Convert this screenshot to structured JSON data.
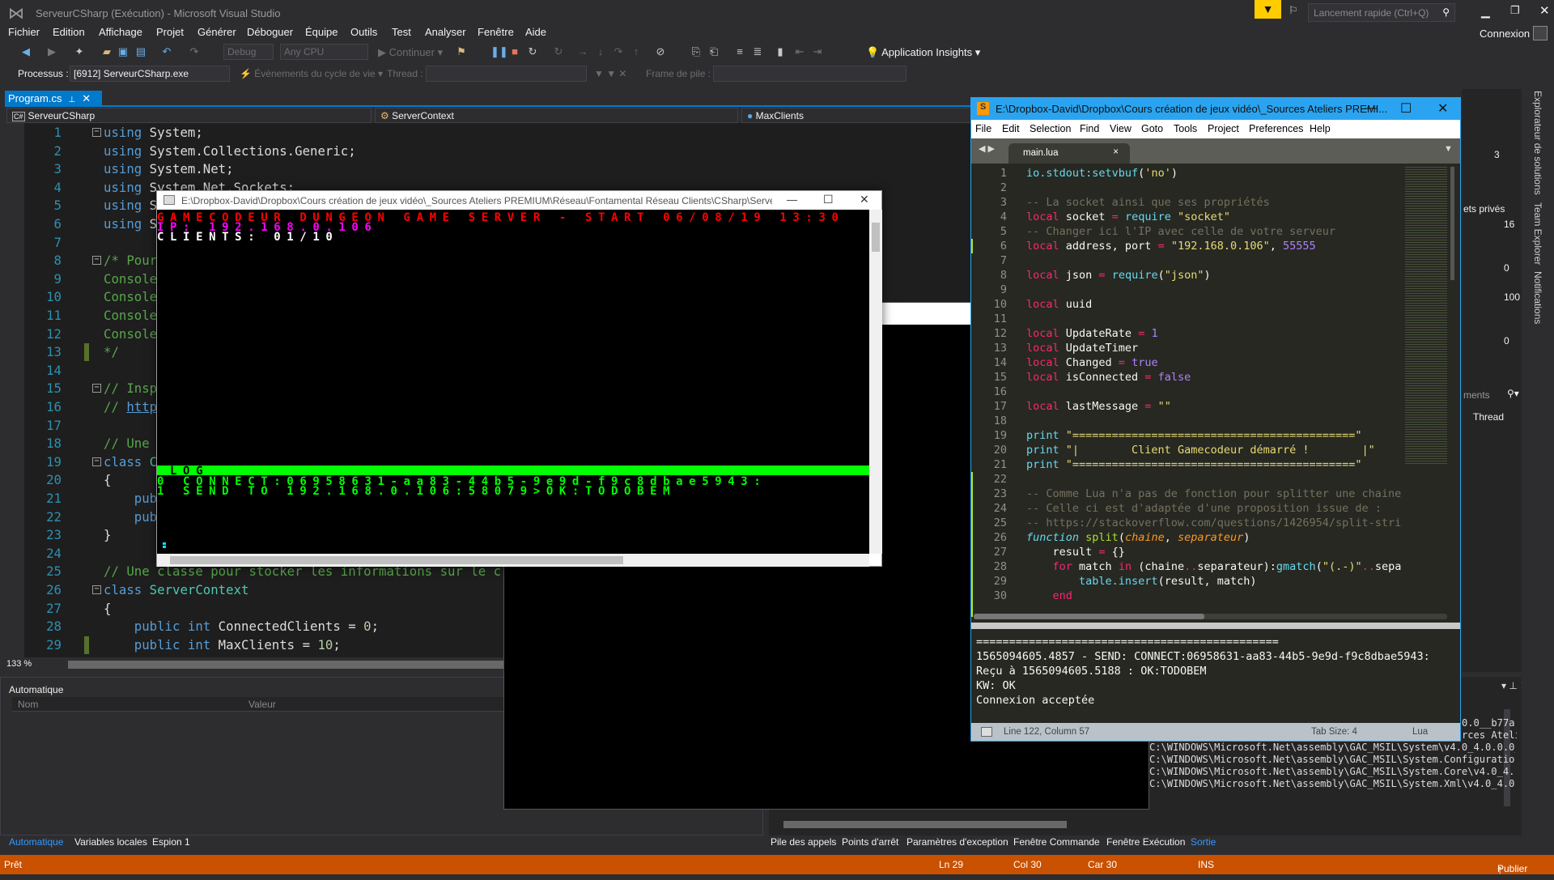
{
  "vs": {
    "title": "ServeurCSharp (Exécution) - Microsoft Visual Studio",
    "menu": [
      "Fichier",
      "Edition",
      "Affichage",
      "Projet",
      "Générer",
      "Déboguer",
      "Équipe",
      "Outils",
      "Test",
      "Analyser",
      "Fenêtre",
      "Aide"
    ],
    "toolbar": {
      "config": "Debug",
      "platform": "Any CPU",
      "continue": "Continuer",
      "app_insights": "Application Insights"
    },
    "debug_location": {
      "process_label": "Processus :",
      "process_value": "[6912] ServeurCSharp.exe",
      "lifecycle": "Événements du cycle de vie",
      "thread_label": "Thread :",
      "frame_label": "Frame de pile :"
    },
    "quick_launch_placeholder": "Lancement rapide (Ctrl+Q)",
    "signin": "Connexion",
    "doc_tab": "Program.cs",
    "nav": {
      "project": "ServeurCSharp",
      "class": "ServerContext",
      "member": "MaxClients"
    },
    "code_lines": [
      {
        "n": "1",
        "fold": "−",
        "seg": [
          [
            "using",
            "kw"
          ],
          [
            " System;",
            "tx"
          ]
        ]
      },
      {
        "n": "2",
        "seg": [
          [
            "using",
            "kw"
          ],
          [
            " System.Collections.Generic;",
            "tx"
          ]
        ]
      },
      {
        "n": "3",
        "seg": [
          [
            "using",
            "kw"
          ],
          [
            " System.Net;",
            "tx"
          ]
        ]
      },
      {
        "n": "4",
        "seg": [
          [
            "using",
            "kw"
          ],
          [
            " System.Net.Sockets;",
            "tx"
          ]
        ]
      },
      {
        "n": "5",
        "seg": [
          [
            "using",
            "kw"
          ],
          [
            " S",
            "tx"
          ]
        ]
      },
      {
        "n": "6",
        "seg": [
          [
            "using",
            "kw"
          ],
          [
            " S",
            "tx"
          ]
        ]
      },
      {
        "n": "7",
        "seg": []
      },
      {
        "n": "8",
        "fold": "−",
        "seg": [
          [
            "/* Pour",
            "cm"
          ]
        ]
      },
      {
        "n": "9",
        "seg": [
          [
            "Console",
            "cm"
          ]
        ]
      },
      {
        "n": "10",
        "seg": [
          [
            "Console",
            "cm"
          ]
        ]
      },
      {
        "n": "11",
        "seg": [
          [
            "Console",
            "cm"
          ]
        ]
      },
      {
        "n": "12",
        "seg": [
          [
            "Console",
            "cm"
          ]
        ]
      },
      {
        "n": "13",
        "mark": true,
        "seg": [
          [
            "*/",
            "cm"
          ]
        ]
      },
      {
        "n": "14",
        "seg": []
      },
      {
        "n": "15",
        "fold": "−",
        "seg": [
          [
            "// Insp",
            "cm"
          ]
        ]
      },
      {
        "n": "16",
        "seg": [
          [
            "// ",
            "cm"
          ],
          [
            "http",
            "ln"
          ]
        ]
      },
      {
        "n": "17",
        "seg": []
      },
      {
        "n": "18",
        "seg": [
          [
            "// Une",
            "cm"
          ]
        ]
      },
      {
        "n": "19",
        "fold": "−",
        "seg": [
          [
            "class",
            "kw"
          ],
          [
            " C",
            "ty"
          ]
        ]
      },
      {
        "n": "20",
        "seg": [
          [
            "{",
            "tx"
          ]
        ]
      },
      {
        "n": "21",
        "seg": [
          [
            "    pub",
            "kw"
          ]
        ]
      },
      {
        "n": "22",
        "seg": [
          [
            "    pub",
            "kw"
          ]
        ]
      },
      {
        "n": "23",
        "seg": [
          [
            "}",
            "tx"
          ]
        ]
      },
      {
        "n": "24",
        "seg": []
      },
      {
        "n": "25",
        "seg": [
          [
            "// Une classe pour stocker les informations sur le c",
            "cm"
          ]
        ]
      },
      {
        "n": "26",
        "fold": "−",
        "seg": [
          [
            "class",
            "kw"
          ],
          [
            " ServerContext",
            "ty"
          ]
        ]
      },
      {
        "n": "27",
        "seg": [
          [
            "{",
            "tx"
          ]
        ]
      },
      {
        "n": "28",
        "seg": [
          [
            "    public",
            "kw"
          ],
          [
            " int",
            "kw"
          ],
          [
            " ConnectedClients = ",
            "tx"
          ],
          [
            "0",
            "nu"
          ],
          [
            ";",
            "tx"
          ]
        ]
      },
      {
        "n": "29",
        "mark": true,
        "seg": [
          [
            "    public",
            "kw"
          ],
          [
            " int",
            "kw"
          ],
          [
            " MaxClients = ",
            "tx"
          ],
          [
            "10",
            "nu"
          ],
          [
            ";",
            "tx"
          ]
        ]
      }
    ],
    "zoom": "133 %",
    "autos": {
      "title": "Automatique",
      "col_name": "Nom",
      "col_value": "Valeur",
      "tabs": [
        "Automatique",
        "Variables locales",
        "Espion 1"
      ]
    },
    "output": {
      "tails": [
        "0.0__b77a",
        "rces Ateli"
      ],
      "lines": [
        "C:\\WINDOWS\\Microsoft.Net\\assembly\\GAC_MSIL\\System\\v4.0_4.0.0.0__",
        "C:\\WINDOWS\\Microsoft.Net\\assembly\\GAC_MSIL\\System.Configuration\\",
        "C:\\WINDOWS\\Microsoft.Net\\assembly\\GAC_MSIL\\System.Core\\v4.0_4.0.0",
        "C:\\WINDOWS\\Microsoft.Net\\assembly\\GAC_MSIL\\System.Xml\\v4.0_4.0.0"
      ]
    },
    "bottom_tabs": [
      "Pile des appels",
      "Points d'arrêt",
      "Paramètres d'exception",
      "Fenêtre Commande",
      "Fenêtre Exécution",
      "Sortie"
    ],
    "status": {
      "ready": "Prêt",
      "ln": "Ln 29",
      "col": "Col 30",
      "car": "Car 30",
      "ins": "INS",
      "publish": "Publier"
    },
    "side_tabs": [
      "Explorateur de solutions",
      "Team Explorer",
      "Notifications"
    ],
    "right_fragments": {
      "value1": "3",
      "private": "ets privés",
      "max1": "16",
      "min1": "0",
      "max2": "100",
      "min2": "0",
      "search": "ments",
      "thread": "Thread"
    },
    "accent": "#007acc",
    "status_color": "#ca5100"
  },
  "console": {
    "title": "E:\\Dropbox-David\\Dropbox\\Cours création de jeux vidéo\\_Sources Ateliers PREMIUM\\Réseau\\Fontamental Réseau Clients\\CSharp\\Serve...",
    "header_lines": [
      {
        "text": "GAMECODEUR DUNGEON GAME SERVER - START 06/08/19 13:30",
        "color": "#ff0000"
      },
      {
        "text": "IP: 192.168.0.106",
        "color": "#ff00ff"
      },
      {
        "text": "CLIENTS: 01/10",
        "color": "#ffffff"
      }
    ],
    "log_header": " LOG",
    "log_lines": [
      "0 CONNECT:06958631-aa83-44b5-9e9d-f9c8dbae5943:",
      "1 SEND TO 192.168.0.106:58079>OK:TODOBEM"
    ],
    "log_color": "#00ff00"
  },
  "sublime": {
    "title": "E:\\Dropbox-David\\Dropbox\\Cours création de jeux vidéo\\_Sources Ateliers PREMI...",
    "menu": [
      "File",
      "Edit",
      "Selection",
      "Find",
      "View",
      "Goto",
      "Tools",
      "Project",
      "Preferences",
      "Help"
    ],
    "tab": "main.lua",
    "code_lines": [
      {
        "n": "1",
        "seg": [
          [
            "io.stdout:setvbuf",
            "b"
          ],
          [
            "(",
            "w"
          ],
          [
            "'no'",
            "s"
          ],
          [
            ")",
            "w"
          ]
        ]
      },
      {
        "n": "2",
        "seg": []
      },
      {
        "n": "3",
        "seg": [
          [
            "-- La socket ainsi que ses propriétés",
            "c"
          ]
        ]
      },
      {
        "n": "4",
        "seg": [
          [
            "local",
            "k"
          ],
          [
            " socket ",
            "w"
          ],
          [
            "=",
            "k"
          ],
          [
            " require",
            "b"
          ],
          [
            " \"socket\"",
            "s"
          ]
        ]
      },
      {
        "n": "5",
        "seg": [
          [
            "-- Changer ici l'IP avec celle de votre serveur",
            "c"
          ]
        ]
      },
      {
        "n": "6",
        "seg": [
          [
            "local",
            "k"
          ],
          [
            " address, port ",
            "w"
          ],
          [
            "=",
            "k"
          ],
          [
            " \"192.168.0.106\"",
            "s"
          ],
          [
            ", ",
            "w"
          ],
          [
            "55555",
            "n"
          ]
        ]
      },
      {
        "n": "7",
        "seg": []
      },
      {
        "n": "8",
        "seg": [
          [
            "local",
            "k"
          ],
          [
            " json ",
            "w"
          ],
          [
            "=",
            "k"
          ],
          [
            " require",
            "b"
          ],
          [
            "(",
            "w"
          ],
          [
            "\"json\"",
            "s"
          ],
          [
            ")",
            "w"
          ]
        ]
      },
      {
        "n": "9",
        "seg": []
      },
      {
        "n": "10",
        "seg": [
          [
            "local",
            "k"
          ],
          [
            " uuid",
            "w"
          ]
        ]
      },
      {
        "n": "11",
        "seg": []
      },
      {
        "n": "12",
        "seg": [
          [
            "local",
            "k"
          ],
          [
            " UpdateRate ",
            "w"
          ],
          [
            "=",
            "k"
          ],
          [
            " 1",
            "n"
          ]
        ]
      },
      {
        "n": "13",
        "seg": [
          [
            "local",
            "k"
          ],
          [
            " UpdateTimer",
            "w"
          ]
        ]
      },
      {
        "n": "14",
        "seg": [
          [
            "local",
            "k"
          ],
          [
            " Changed ",
            "w"
          ],
          [
            "=",
            "k"
          ],
          [
            " true",
            "n"
          ]
        ]
      },
      {
        "n": "15",
        "seg": [
          [
            "local",
            "k"
          ],
          [
            " isConnected ",
            "w"
          ],
          [
            "=",
            "k"
          ],
          [
            " false",
            "n"
          ]
        ]
      },
      {
        "n": "16",
        "seg": []
      },
      {
        "n": "17",
        "seg": [
          [
            "local",
            "k"
          ],
          [
            " lastMessage ",
            "w"
          ],
          [
            "=",
            "k"
          ],
          [
            " \"\"",
            "s"
          ]
        ]
      },
      {
        "n": "18",
        "seg": []
      },
      {
        "n": "19",
        "seg": [
          [
            "print",
            "b"
          ],
          [
            " \"===========================================\"",
            "s"
          ]
        ]
      },
      {
        "n": "20",
        "seg": [
          [
            "print",
            "b"
          ],
          [
            " \"|        Client Gamecodeur démarré !        |\"",
            "s"
          ]
        ]
      },
      {
        "n": "21",
        "seg": [
          [
            "print",
            "b"
          ],
          [
            " \"===========================================\"",
            "s"
          ]
        ]
      },
      {
        "n": "22",
        "seg": []
      },
      {
        "n": "23",
        "seg": [
          [
            "-- Comme Lua n'a pas de fonction pour splitter une chaine",
            "c"
          ]
        ]
      },
      {
        "n": "24",
        "seg": [
          [
            "-- Celle ci est d'adaptée d'une proposition issue de :",
            "c"
          ]
        ]
      },
      {
        "n": "25",
        "seg": [
          [
            "-- https://stackoverflow.com/questions/1426954/split-stri",
            "c"
          ]
        ]
      },
      {
        "n": "26",
        "seg": [
          [
            "function",
            "f"
          ],
          [
            " split",
            "g"
          ],
          [
            "(",
            "w"
          ],
          [
            "chaine",
            "p"
          ],
          [
            ", ",
            "w"
          ],
          [
            "separateur",
            "p"
          ],
          [
            ")",
            "w"
          ]
        ]
      },
      {
        "n": "27",
        "seg": [
          [
            "    result ",
            "w"
          ],
          [
            "=",
            "k"
          ],
          [
            " {}",
            "w"
          ]
        ]
      },
      {
        "n": "28",
        "seg": [
          [
            "    for",
            "k"
          ],
          [
            " match ",
            "w"
          ],
          [
            "in",
            "k"
          ],
          [
            " (chaine",
            "w"
          ],
          [
            "..",
            "k"
          ],
          [
            "separateur):",
            "w"
          ],
          [
            "gmatch",
            "b"
          ],
          [
            "(",
            "w"
          ],
          [
            "\"(.-)\"",
            "s"
          ],
          [
            "..",
            "k"
          ],
          [
            "sepa",
            "w"
          ]
        ]
      },
      {
        "n": "29",
        "seg": [
          [
            "        table.insert",
            "b"
          ],
          [
            "(result, match)",
            "w"
          ]
        ]
      },
      {
        "n": "30",
        "seg": [
          [
            "    end",
            "k"
          ]
        ]
      }
    ],
    "output_lines": [
      "==============================================",
      "1565094605.4857 - SEND: CONNECT:06958631-aa83-44b5-9e9d-f9c8dbae5943:",
      "Reçu à 1565094605.5188 : OK:TODOBEM",
      "KW: OK",
      "Connexion acceptée"
    ],
    "status": {
      "position": "Line 122, Column 57",
      "tab_size": "Tab Size: 4",
      "syntax": "Lua"
    },
    "title_color": "#2aa4f0"
  }
}
